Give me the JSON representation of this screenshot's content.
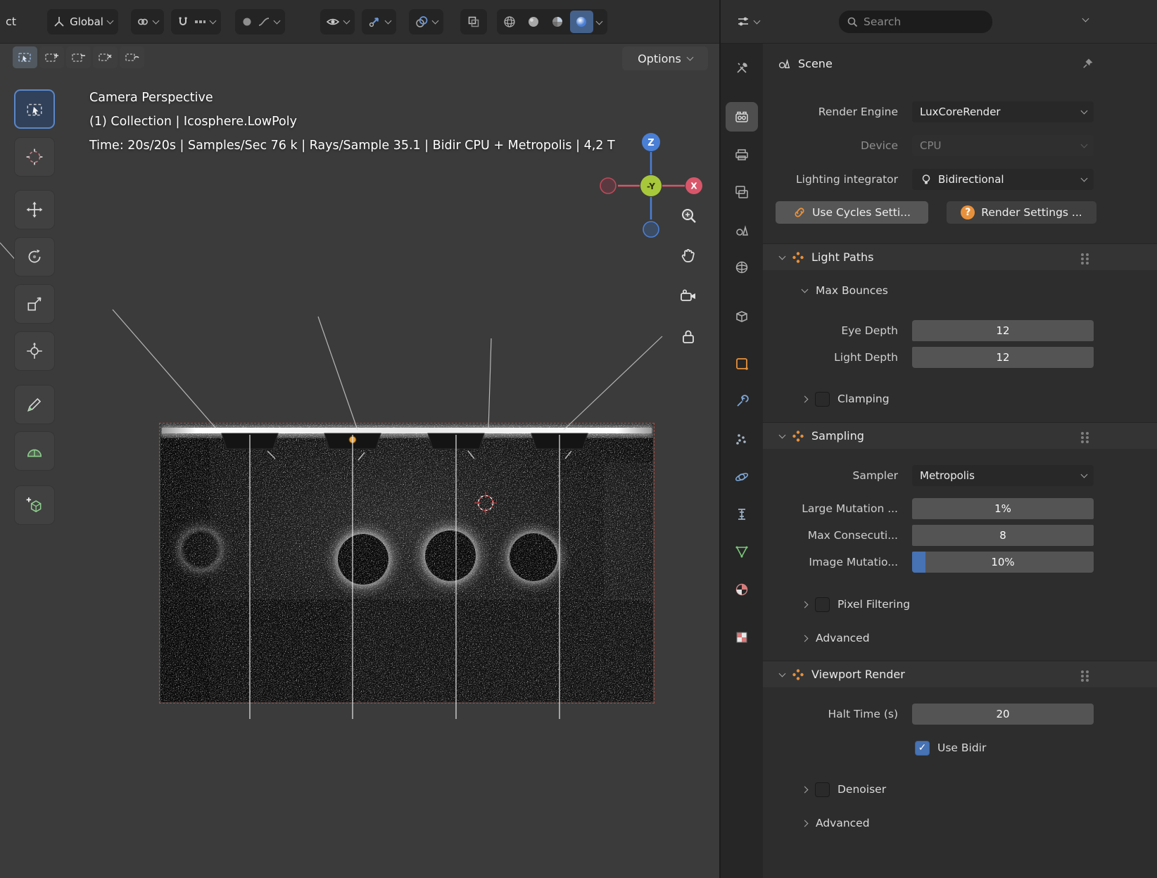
{
  "colors": {
    "accent": "#4772b3",
    "orange": "#e8913c"
  },
  "icons": {
    "question": "?",
    "check": "✓"
  },
  "topbar": {
    "select_menu_partial": "ct",
    "orientation": "Global",
    "search_placeholder": "Search"
  },
  "viewport": {
    "options_button": "Options",
    "header_title": "Camera Perspective",
    "header_collection": "(1) Collection | Icosphere.LowPoly",
    "header_stats": "Time: 20s/20s | Samples/Sec 76 k | Rays/Sample 35.1 | Bidir CPU + Metropolis | 4,2 T",
    "gizmo": {
      "z": "Z",
      "neg_y": "-Y",
      "x": "X"
    },
    "tools": [
      "select-box",
      "cursor",
      "move",
      "rotate",
      "scale",
      "transform",
      "annotate",
      "measure",
      "add-cube"
    ],
    "active_tool": "select-box"
  },
  "properties": {
    "tabs": [
      "tool",
      "render",
      "output",
      "view-layer",
      "scene",
      "world",
      "collection",
      "object",
      "modifiers",
      "particles",
      "physics",
      "constraints",
      "object-data",
      "material",
      "texture"
    ],
    "active_tab": "render",
    "breadcrumb": "Scene",
    "render_engine_label": "Render Engine",
    "render_engine_value": "LuxCoreRender",
    "device_label": "Device",
    "device_value": "CPU",
    "integrator_label": "Lighting integrator",
    "integrator_value": "Bidirectional",
    "use_cycles_button": "Use Cycles Setti...",
    "render_settings_button": "Render Settings ...",
    "light_paths": {
      "title": "Light Paths",
      "max_bounces": "Max Bounces",
      "eye_depth_label": "Eye Depth",
      "eye_depth_value": "12",
      "light_depth_label": "Light Depth",
      "light_depth_value": "12",
      "clamping": "Clamping"
    },
    "sampling": {
      "title": "Sampling",
      "sampler_label": "Sampler",
      "sampler_value": "Metropolis",
      "large_mutation_label": "Large Mutation ...",
      "large_mutation_value": "1%",
      "max_consecutive_label": "Max Consecuti...",
      "max_consecutive_value": "8",
      "image_mutation_label": "Image Mutatio...",
      "image_mutation_value": "10%",
      "pixel_filtering": "Pixel Filtering",
      "advanced": "Advanced"
    },
    "viewport_render": {
      "title": "Viewport Render",
      "halt_time_label": "Halt Time (s)",
      "halt_time_value": "20",
      "use_bidir": "Use Bidir",
      "denoiser": "Denoiser",
      "advanced": "Advanced"
    }
  }
}
